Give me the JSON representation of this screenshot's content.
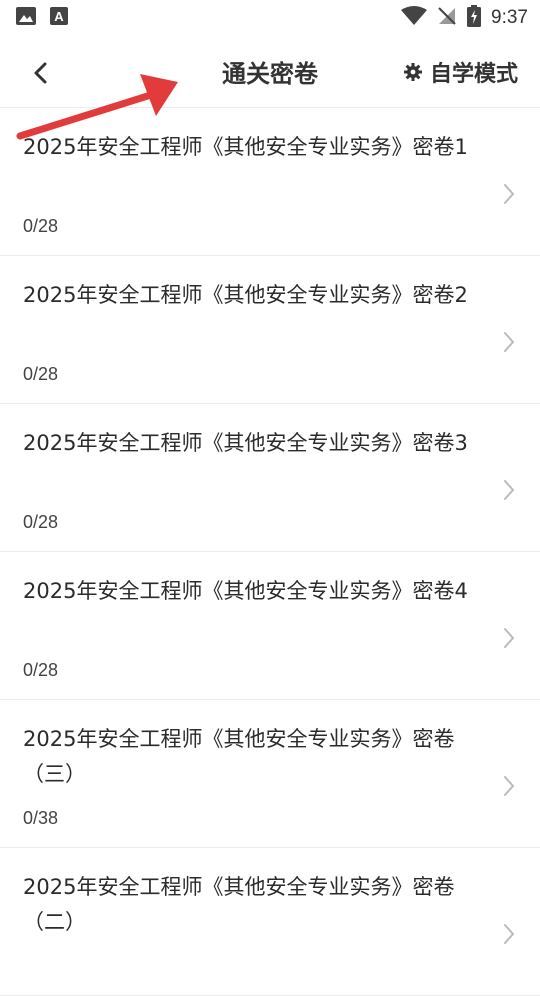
{
  "status_bar": {
    "time": "9:37",
    "icons": [
      "image-icon",
      "font-icon",
      "wifi-icon",
      "no-signal-icon",
      "battery-charging-icon"
    ]
  },
  "header": {
    "title": "通关密卷",
    "mode_label": "自学模式",
    "back_icon": "back-chevron-icon",
    "mode_icon": "gear-icon"
  },
  "annotation": {
    "arrow_color": "#e23b3b"
  },
  "items": [
    {
      "title": "2025年安全工程师《其他安全专业实务》密卷1",
      "progress": "0/28"
    },
    {
      "title": "2025年安全工程师《其他安全专业实务》密卷2",
      "progress": "0/28"
    },
    {
      "title": "2025年安全工程师《其他安全专业实务》密卷3",
      "progress": "0/28"
    },
    {
      "title": "2025年安全工程师《其他安全专业实务》密卷4",
      "progress": "0/28"
    },
    {
      "title": "2025年安全工程师《其他安全专业实务》密卷（三）",
      "progress": "0/38"
    },
    {
      "title": "2025年安全工程师《其他安全专业实务》密卷（二）",
      "progress": ""
    }
  ]
}
